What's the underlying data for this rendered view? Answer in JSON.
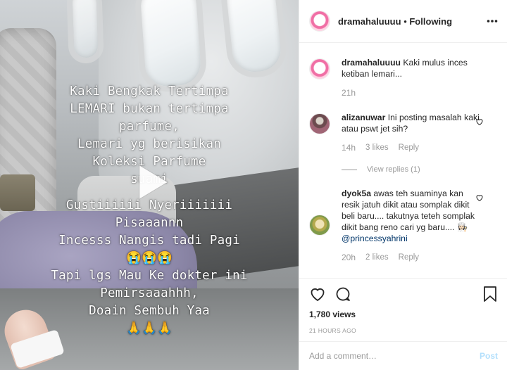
{
  "post": {
    "caption_lines": [
      "Kaki Bengkak Tertimpa",
      "LEMARI bukan tertimpa",
      "parfume,",
      "Lemari yg berisikan",
      "Koleksi Parfume",
      "suami",
      "Gustiiiiii Nyeriiiiiii",
      "Pisaaannn",
      "Incesss Nangis tadi Pagi",
      "😭😭😭",
      "Tapi lgs Mau Ke dokter ini",
      "Pemirsaaahhh,",
      "Doain Sembuh Yaa",
      "🙏🙏🙏"
    ]
  },
  "header": {
    "username": "dramahaluuuu",
    "separator": " • ",
    "follow_status": "Following"
  },
  "comments": [
    {
      "username": "dramahaluuuu",
      "text": "Kaki mulus inces ketiban lemari...",
      "time": "21h"
    },
    {
      "username": "alizanuwar",
      "text": "Ini posting masalah kaki atau pswt jet sih?",
      "time": "14h",
      "likes": "3 likes",
      "reply": "Reply",
      "view_replies": "View replies (1)"
    },
    {
      "username": "dyok5a",
      "text": "awas teh suaminya kan resik jatuh dikit atau somplak dikit beli baru.... takutnya teteh somplak dikit bang reno cari yg baru.... 👩🏻‍🍳",
      "mention": "@princessyahrini",
      "time": "20h",
      "likes": "2 likes",
      "reply": "Reply"
    }
  ],
  "stats": {
    "views": "1,780 views",
    "posted": "21 HOURS AGO"
  },
  "add_comment": {
    "placeholder": "Add a comment…",
    "post_label": "Post"
  },
  "icons": {
    "more": "more-options-icon",
    "like": "heart-icon",
    "comment": "comment-bubble-icon",
    "save": "bookmark-icon",
    "play": "play-icon"
  },
  "colors": {
    "text": "#262626",
    "muted": "#999999",
    "link": "#003569",
    "post_disabled": "#b2dffc",
    "divider": "#efefef"
  }
}
